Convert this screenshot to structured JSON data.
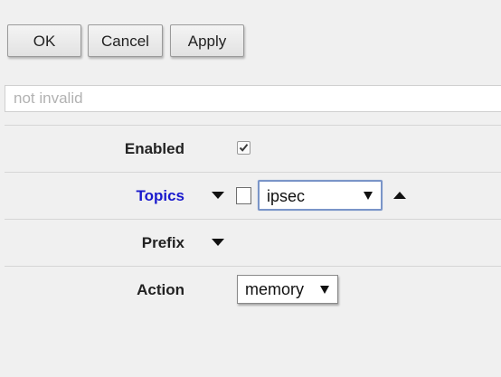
{
  "toolbar": {
    "ok_label": "OK",
    "cancel_label": "Cancel",
    "apply_label": "Apply"
  },
  "status": {
    "text": "not invalid"
  },
  "form": {
    "enabled": {
      "label": "Enabled",
      "checked": true
    },
    "topics": {
      "label": "Topics",
      "checked": false,
      "value": "ipsec"
    },
    "prefix": {
      "label": "Prefix"
    },
    "action": {
      "label": "Action",
      "value": "memory"
    }
  },
  "colors": {
    "background": "#f0f0f0",
    "link_label": "#1a1acd",
    "focused_select_border": "#7a95c8"
  }
}
